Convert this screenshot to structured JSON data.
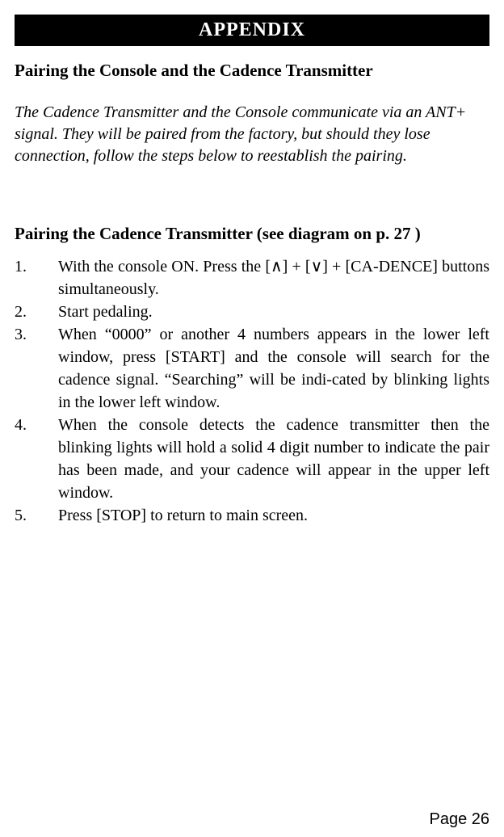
{
  "header": {
    "label": "APPENDIX"
  },
  "section": {
    "title": "Pairing the Console and the Cadence Transmitter",
    "intro": "The Cadence Transmitter and the Console communicate via an ANT+ signal.  They will be paired from the factory, but should they lose connection, follow the steps below to reestablish the pairing."
  },
  "subsection": {
    "title": "Pairing the Cadence Transmitter (see diagram on p. 27 )"
  },
  "steps": [
    {
      "num": "1.",
      "text": "With the console ON.  Press the [∧] + [∨] + [CA-DENCE] buttons simultaneously."
    },
    {
      "num": "2.",
      "text": "Start pedaling."
    },
    {
      "num": "3.",
      "text": "When “0000” or another 4 numbers appears in the lower left window, press [START] and the console will search for the cadence signal.  “Searching” will be indi-cated by blinking lights in the lower left window."
    },
    {
      "num": "4.",
      "text": "When the console detects the cadence transmitter then the blinking lights will hold a solid 4 digit number to indicate the pair has been made, and your cadence will appear in the upper left window."
    },
    {
      "num": "5.",
      "text": "Press [STOP] to return to main screen."
    }
  ],
  "footer": {
    "page": "Page 26"
  }
}
